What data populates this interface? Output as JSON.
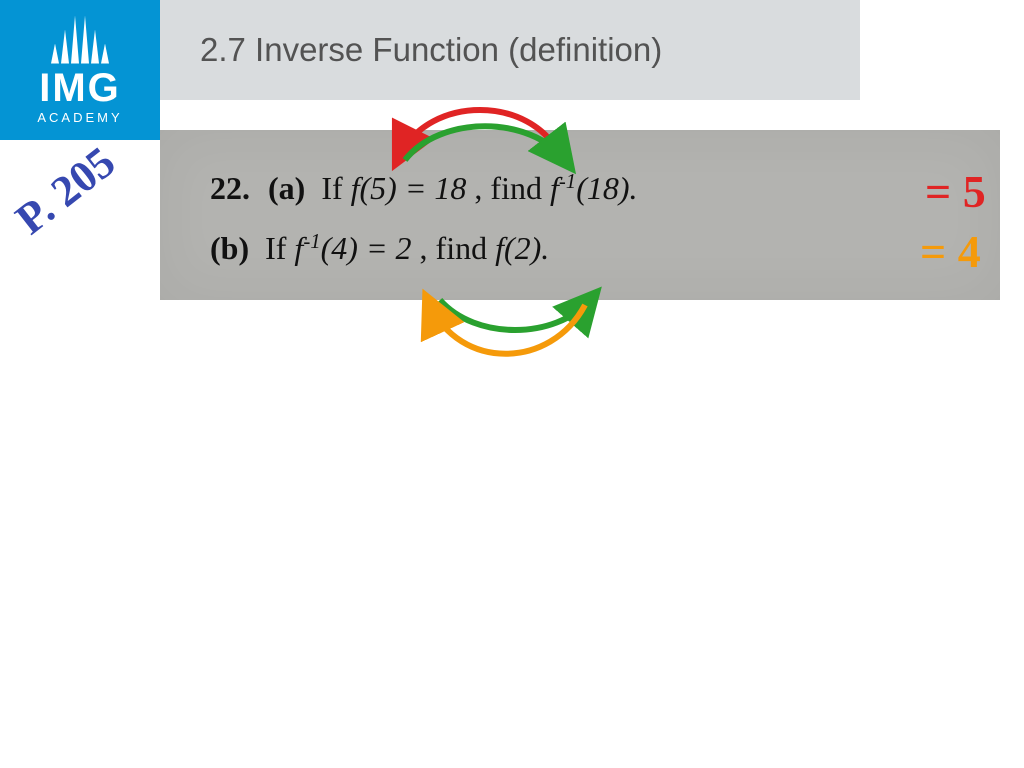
{
  "logo": {
    "line1": "IMG",
    "line2": "ACADEMY"
  },
  "title": "2.7 Inverse Function (definition)",
  "question": {
    "number": "22.",
    "a": {
      "label": "(a)",
      "if": "If ",
      "fn1": "f(5) = 18",
      "find": ", find ",
      "fn2": "f⁻¹(18)."
    },
    "b": {
      "label": "(b)",
      "if": "If ",
      "fn1": "f⁻¹(4) = 2",
      "find": ", find ",
      "fn2": "f(2)."
    }
  },
  "annot": {
    "page_ref": "P. 205",
    "ans_a": "= 5",
    "ans_b": "= 4"
  },
  "colors": {
    "brand": "#0494d4",
    "hand_blue": "#3648b0",
    "hand_red": "#e02424",
    "hand_orange": "#f59a0a",
    "hand_green": "#2aa12f"
  }
}
